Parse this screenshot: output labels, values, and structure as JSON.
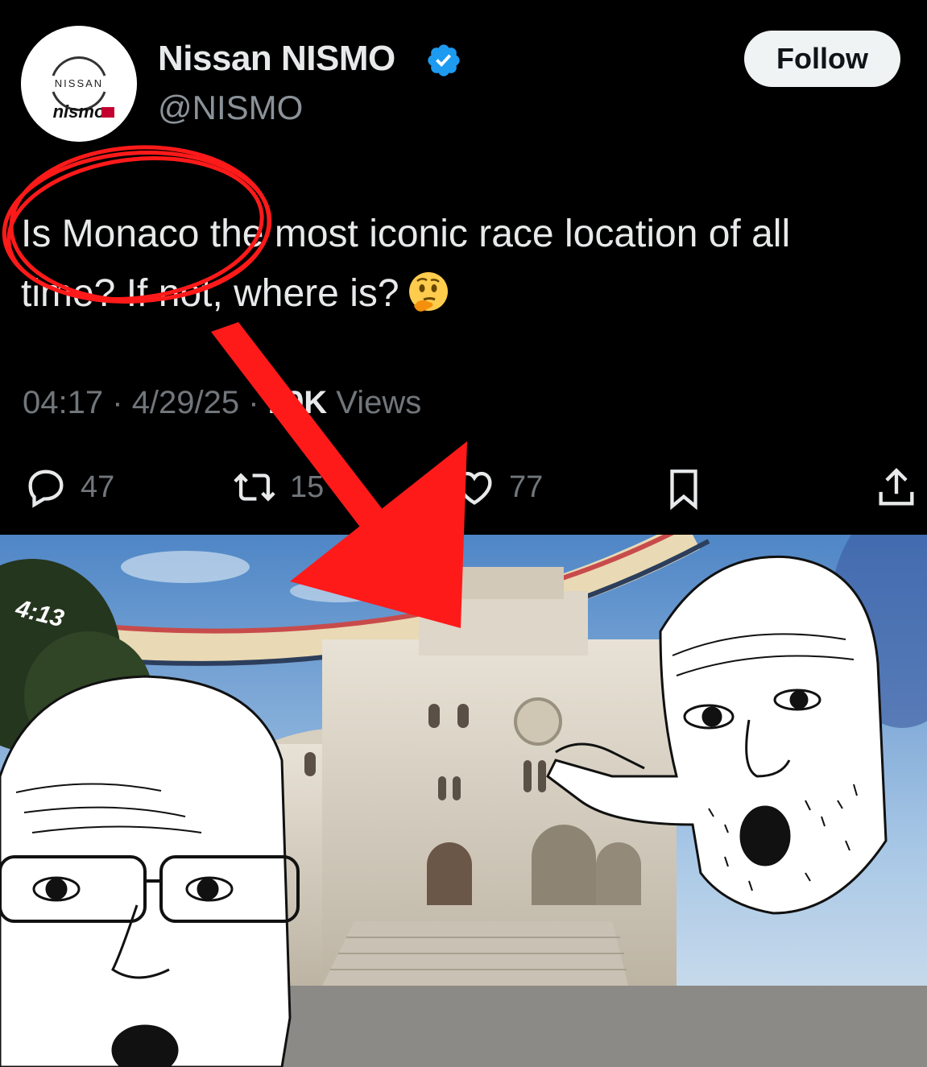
{
  "account": {
    "display_name": "Nissan NISMO",
    "handle": "@NISMO",
    "avatar_logo_top": "NISSAN",
    "avatar_logo_bottom": "nismo",
    "verified": true
  },
  "follow_label": "Follow",
  "tweet": {
    "line1": "Is Monaco the most iconic race location of all",
    "line2": "time? If not, where is?",
    "emoji": "thinking-face"
  },
  "meta": {
    "time": "04:17",
    "separator": "·",
    "date": "4/29/25",
    "views_count": "19K",
    "views_label": "Views"
  },
  "actions": {
    "replies": "47",
    "reposts": "15",
    "likes": "77"
  },
  "meme": {
    "hud_timer": "4:13"
  },
  "colors": {
    "background": "#000000",
    "text": "#e7e9ea",
    "muted": "#71767b",
    "verified": "#1d9bf0",
    "annotation_red": "#ff1a1a"
  }
}
